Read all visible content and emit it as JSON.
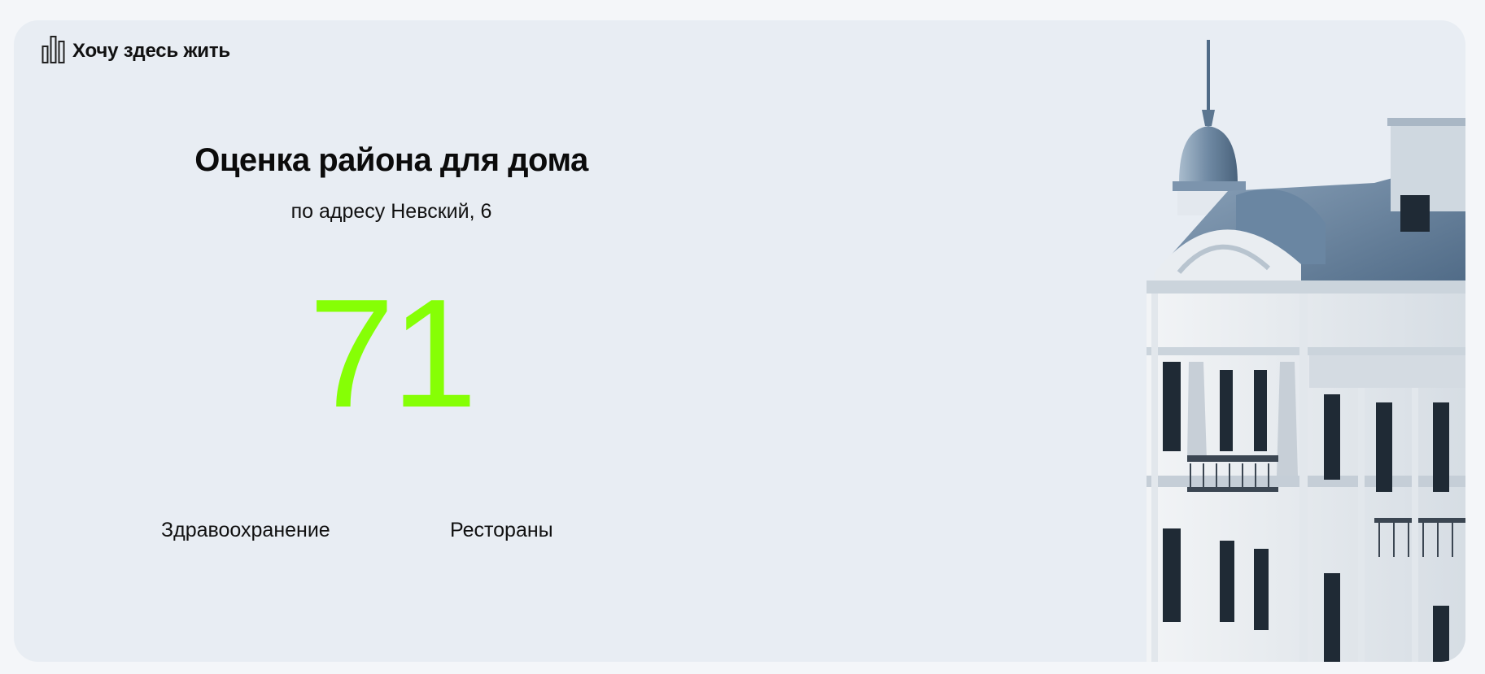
{
  "brand": {
    "name": "Хочу здесь жить",
    "icon": "bar-chart-icon"
  },
  "heading": {
    "title": "Оценка района для дома",
    "subtitle": "по адресу Невский, 6"
  },
  "score": {
    "value": "71",
    "color": "#86ff05"
  },
  "categories": [
    {
      "label": "Здравоохранение"
    },
    {
      "label": "Рестораны"
    }
  ],
  "colors": {
    "background": "#f4f6f9",
    "card": "#e8edf3",
    "accent": "#86ff05"
  }
}
